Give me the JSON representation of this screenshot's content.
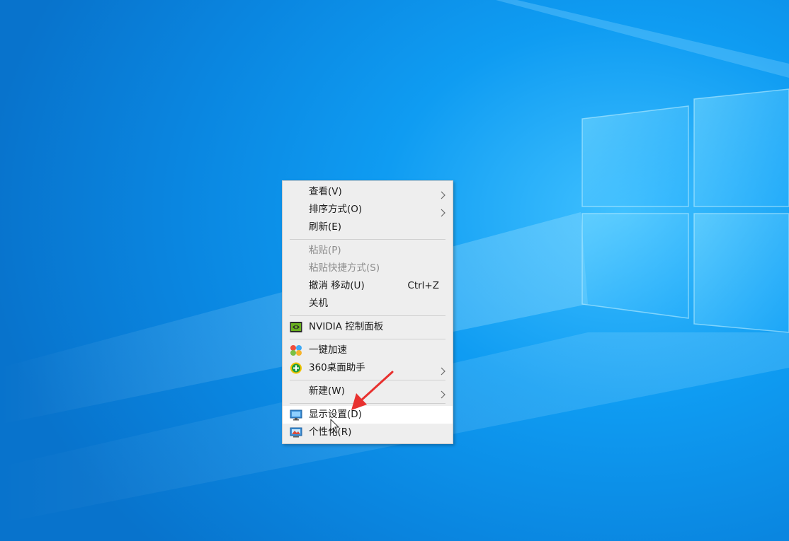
{
  "desktop": {
    "wallpaper": "windows-10-hero",
    "accent": "#0a86e0"
  },
  "context_menu": {
    "groups": [
      [
        {
          "label": "查看(V)",
          "submenu": true,
          "disabled": false
        },
        {
          "label": "排序方式(O)",
          "submenu": true,
          "disabled": false
        },
        {
          "label": "刷新(E)",
          "submenu": false,
          "disabled": false
        }
      ],
      [
        {
          "label": "粘贴(P)",
          "submenu": false,
          "disabled": true
        },
        {
          "label": "粘贴快捷方式(S)",
          "submenu": false,
          "disabled": true
        },
        {
          "label": "撤消 移动(U)",
          "shortcut": "Ctrl+Z",
          "submenu": false,
          "disabled": false
        },
        {
          "label": "关机",
          "submenu": false,
          "disabled": false
        }
      ],
      [
        {
          "label": "NVIDIA 控制面板",
          "icon": "nvidia-icon",
          "submenu": false,
          "disabled": false
        }
      ],
      [
        {
          "label": "一键加速",
          "icon": "speedup-icon",
          "submenu": false,
          "disabled": false
        },
        {
          "label": "360桌面助手",
          "icon": "360-assistant-icon",
          "submenu": true,
          "disabled": false
        }
      ],
      [
        {
          "label": "新建(W)",
          "submenu": true,
          "disabled": false
        }
      ],
      [
        {
          "label": "显示设置(D)",
          "icon": "display-settings-icon",
          "submenu": false,
          "disabled": false,
          "highlighted": true
        },
        {
          "label": "个性化(R)",
          "icon": "personalize-icon",
          "submenu": false,
          "disabled": false
        }
      ]
    ]
  },
  "annotation": {
    "arrow_color": "#e8312f"
  }
}
